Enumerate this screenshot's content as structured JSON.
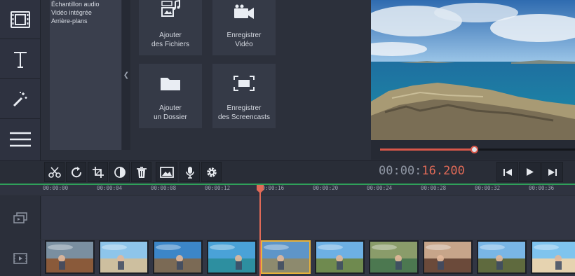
{
  "library": {
    "items": [
      "Échantillon audio",
      "Vidéo intégrée",
      "Arrière-plans"
    ]
  },
  "rail": {
    "items": [
      "film-icon",
      "text-icon",
      "magic-wand-icon",
      "menu-icon"
    ]
  },
  "import_tiles": [
    {
      "line1": "Ajouter",
      "line2": "des Fichiers",
      "icon": "add-files-icon"
    },
    {
      "line1": "Enregistrer",
      "line2": "Vidéo",
      "icon": "camera-icon"
    },
    {
      "line1": "Ajouter",
      "line2": "un Dossier",
      "icon": "folder-icon"
    },
    {
      "line1": "Enregistrer",
      "line2": "des Screencasts",
      "icon": "screencast-icon"
    }
  ],
  "player": {
    "time_prefix": "00:00:",
    "time_value": "16.200",
    "progress": 0.483
  },
  "toolbar": {
    "tools": [
      "cut-icon",
      "rotate-icon",
      "crop-icon",
      "color-icon",
      "delete-icon",
      "image-icon",
      "microphone-icon",
      "settings-icon"
    ]
  },
  "transport": [
    "skip-back-icon",
    "play-icon",
    "skip-forward-icon"
  ],
  "ruler": {
    "labels": [
      "00:00:00",
      "00:00:04",
      "00:00:08",
      "00:00:12",
      "00:00:16",
      "00:00:20",
      "00:00:24",
      "00:00:28",
      "00:00:32",
      "00:00:36"
    ]
  },
  "tracks": [
    "overlay-track-icon",
    "video-track-icon"
  ],
  "clips": [
    {
      "scene": "couple",
      "sky": "#7a8fa0",
      "ground": "#8a5a3a"
    },
    {
      "scene": "beach",
      "sky": "#8ec5ea",
      "ground": "#cdbf9f"
    },
    {
      "scene": "hiker",
      "sky": "#3c86c8",
      "ground": "#7b6a55"
    },
    {
      "scene": "sea",
      "sky": "#4aa2d8",
      "ground": "#2d8fa0"
    },
    {
      "scene": "cliff",
      "sky": "#5e95c8",
      "ground": "#8d8a6e",
      "selected": true
    },
    {
      "scene": "jump",
      "sky": "#6db0e4",
      "ground": "#6f8a4f"
    },
    {
      "scene": "boats",
      "sky": "#8a9c6a",
      "ground": "#4c7850"
    },
    {
      "scene": "couple2",
      "sky": "#c7a58a",
      "ground": "#6b4a3a"
    },
    {
      "scene": "road",
      "sky": "#79b6e6",
      "ground": "#5f6a3e"
    },
    {
      "scene": "beach2",
      "sky": "#7fc4ee",
      "ground": "#e6d3b0"
    }
  ]
}
